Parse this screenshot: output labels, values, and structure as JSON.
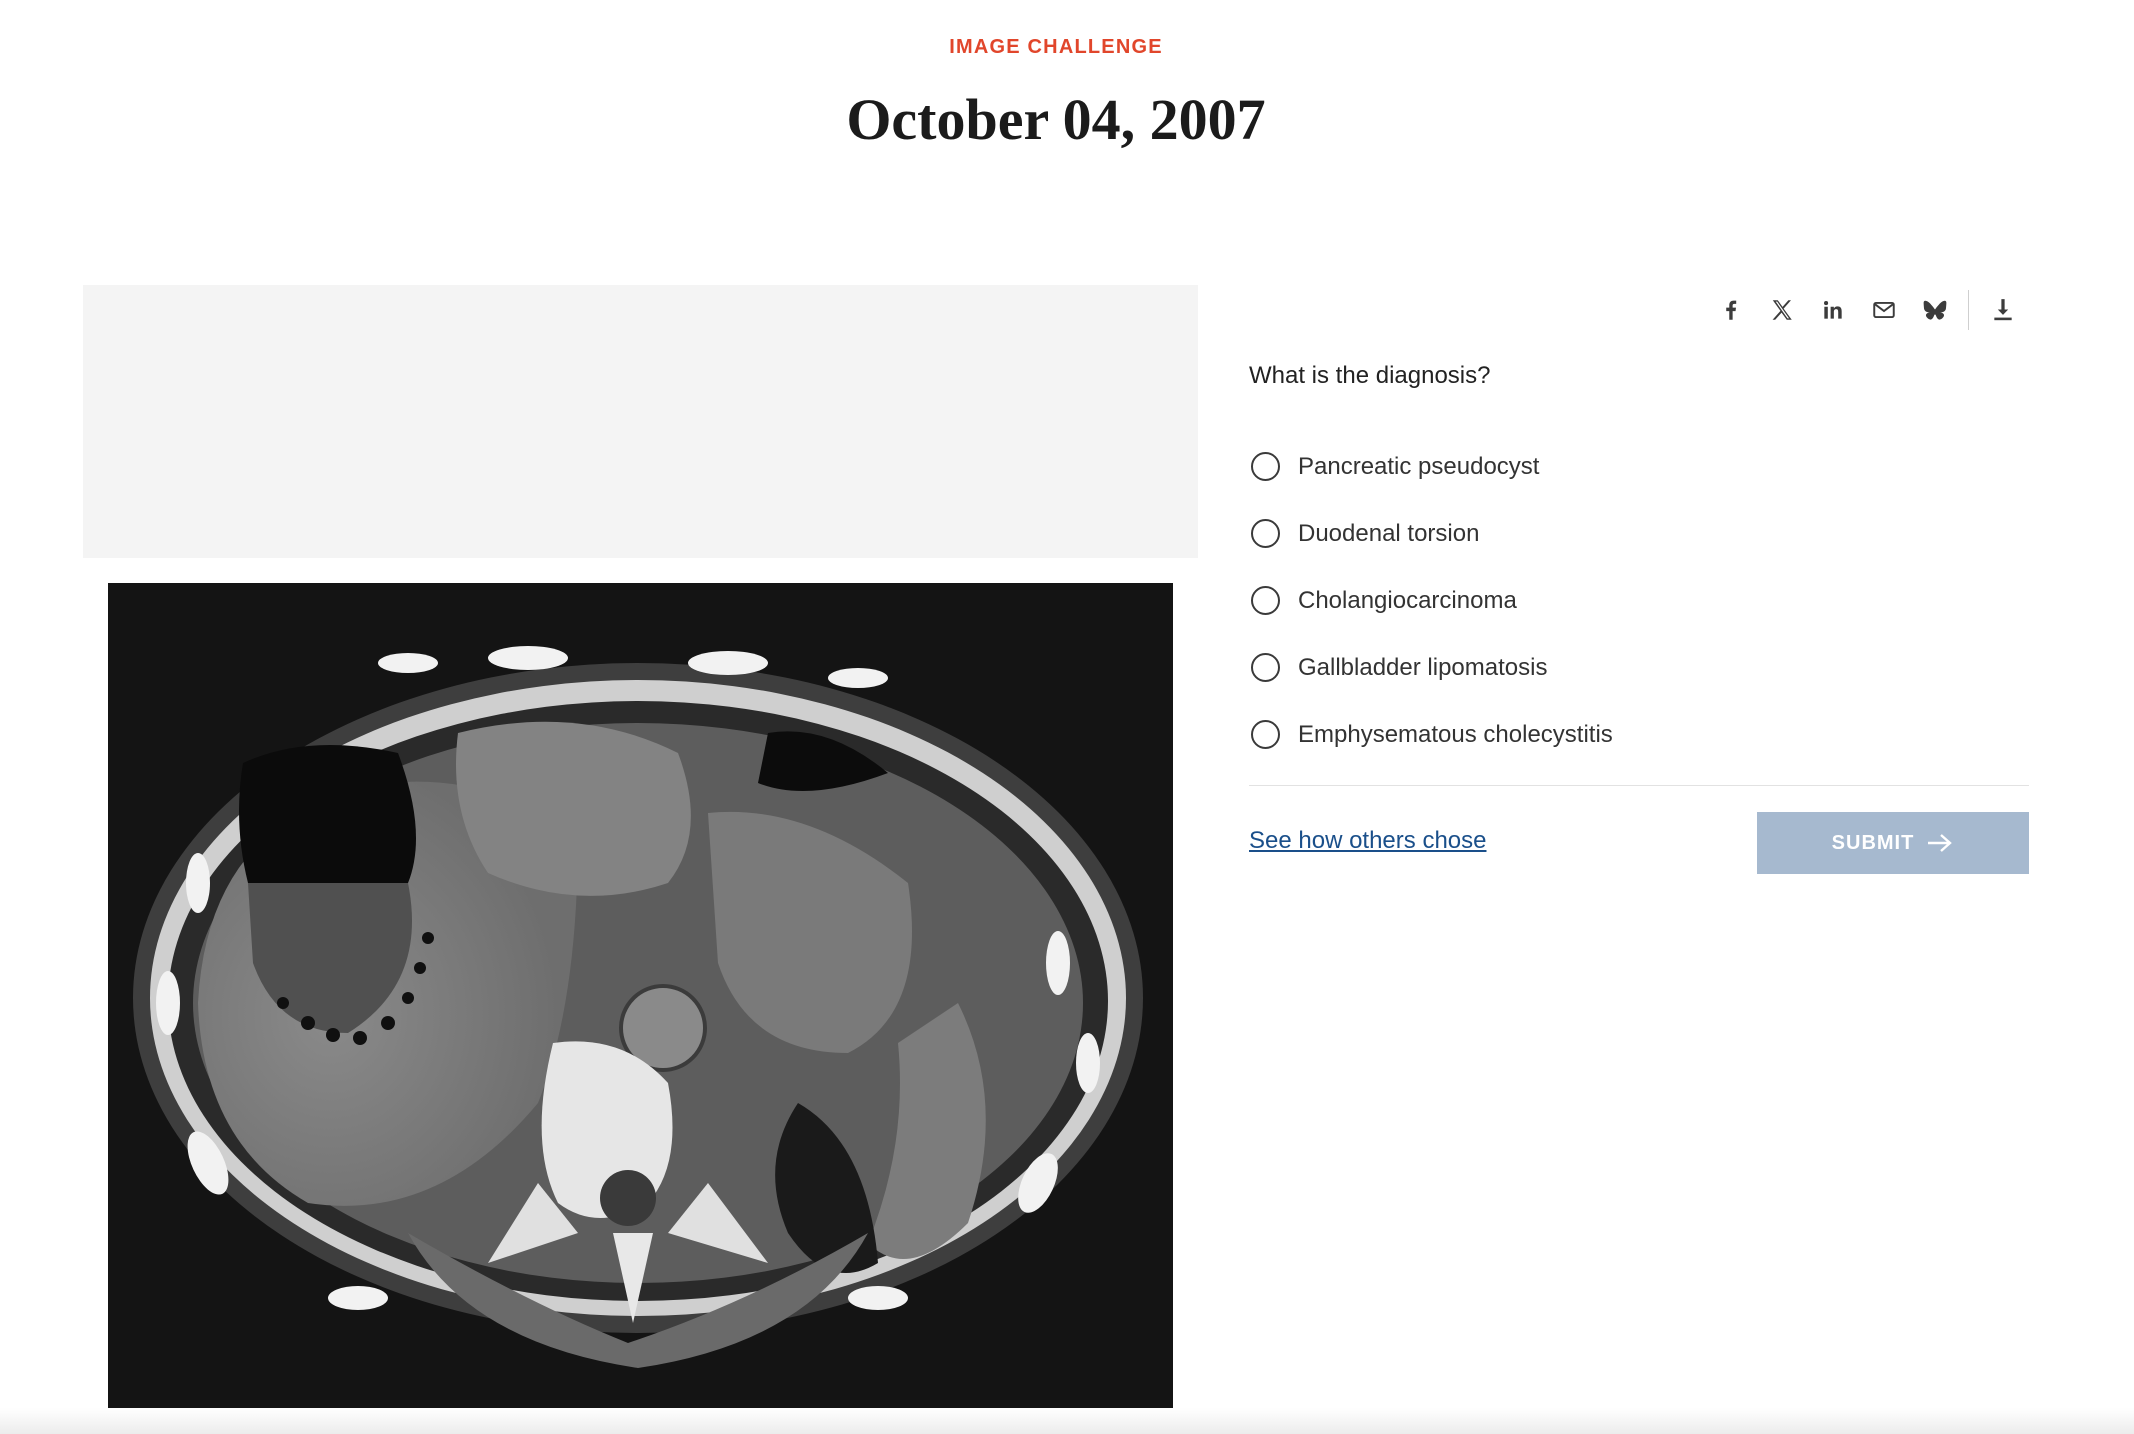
{
  "header": {
    "eyebrow": "IMAGE CHALLENGE",
    "date": "October 04, 2007"
  },
  "share": {
    "icons": [
      "facebook-icon",
      "x-twitter-icon",
      "linkedin-icon",
      "email-icon",
      "bluesky-icon",
      "download-icon"
    ]
  },
  "quiz": {
    "question": "What is the diagnosis?",
    "options": [
      "Pancreatic pseudocyst",
      "Duodenal torsion",
      "Cholangiocarcinoma",
      "Gallbladder lipomatosis",
      "Emphysematous cholecystitis"
    ],
    "see_others": "See how others chose",
    "submit_label": "SUBMIT"
  },
  "colors": {
    "accent": "#e1462b",
    "link": "#1a4f8a",
    "submit_disabled": "#a6b9cf"
  }
}
